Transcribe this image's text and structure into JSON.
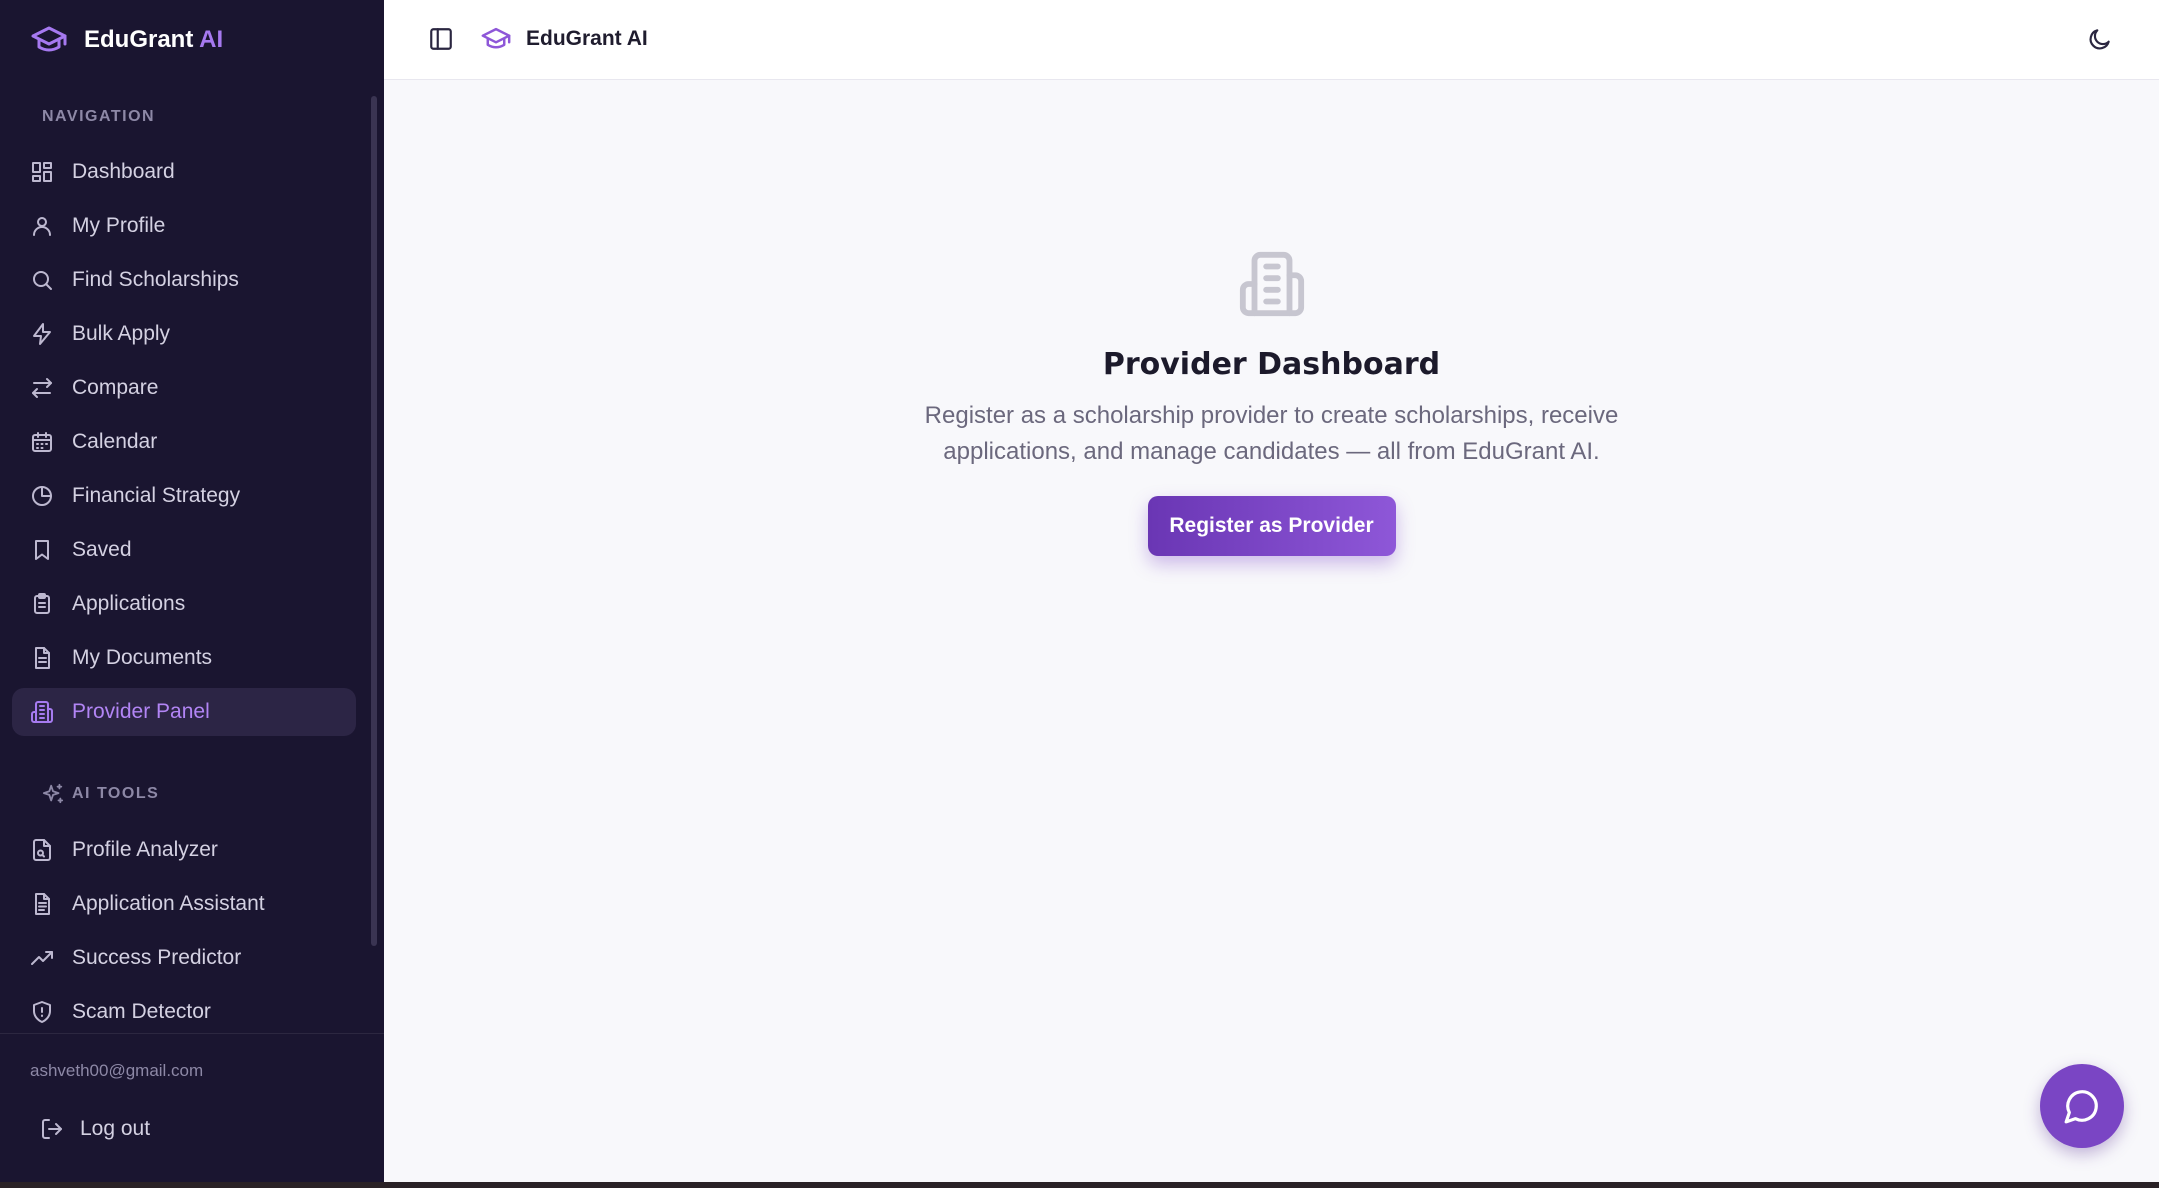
{
  "brand": {
    "name": "EduGrant",
    "suffix": "AI",
    "full": "EduGrant AI"
  },
  "colors": {
    "accent": "#8e57d8",
    "sidebar_bg": "#1a1530",
    "active_item_bg": "#2c2545"
  },
  "sidebar": {
    "nav_section": "NAVIGATION",
    "nav_items": [
      {
        "label": "Dashboard",
        "icon": "dashboard-grid-icon"
      },
      {
        "label": "My Profile",
        "icon": "user-icon"
      },
      {
        "label": "Find Scholarships",
        "icon": "search-icon"
      },
      {
        "label": "Bulk Apply",
        "icon": "lightning-icon"
      },
      {
        "label": "Compare",
        "icon": "arrows-swap-icon"
      },
      {
        "label": "Calendar",
        "icon": "calendar-icon"
      },
      {
        "label": "Financial Strategy",
        "icon": "pie-chart-icon"
      },
      {
        "label": "Saved",
        "icon": "bookmark-icon"
      },
      {
        "label": "Applications",
        "icon": "clipboard-icon"
      },
      {
        "label": "My Documents",
        "icon": "document-icon"
      },
      {
        "label": "Provider Panel",
        "icon": "building-icon",
        "active": true
      }
    ],
    "ai_section": "AI TOOLS",
    "ai_items": [
      {
        "label": "Profile Analyzer",
        "icon": "file-search-icon"
      },
      {
        "label": "Application Assistant",
        "icon": "document-text-icon"
      },
      {
        "label": "Success Predictor",
        "icon": "trending-up-icon"
      },
      {
        "label": "Scam Detector",
        "icon": "shield-icon"
      }
    ],
    "footer": {
      "email": "ashveth00@gmail.com",
      "logout": "Log out"
    }
  },
  "header": {
    "title": "EduGrant AI"
  },
  "main": {
    "title": "Provider Dashboard",
    "description": "Register as a scholarship provider to create scholarships, receive applications, and manage candidates — all from EduGrant AI.",
    "cta": "Register as Provider"
  }
}
